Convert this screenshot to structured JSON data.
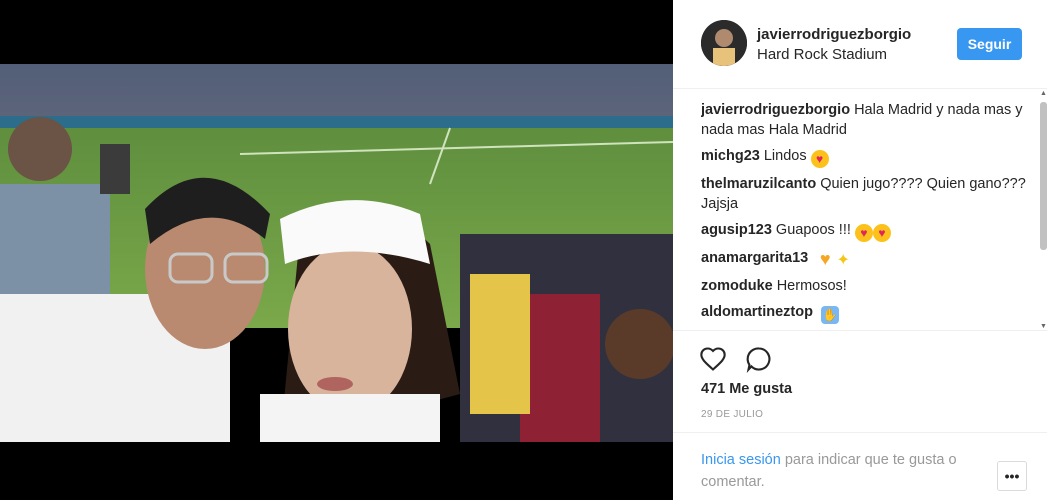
{
  "post": {
    "username": "javierrodriguezborgio",
    "location": "Hard Rock Stadium",
    "follow_label": "Seguir",
    "likes": "471 Me gusta",
    "date": "29 DE JULIO"
  },
  "comments": [
    {
      "user": "javierrodriguezborgio",
      "text": "Hala Madrid y nada mas y nada mas Hala Madrid",
      "emojis": []
    },
    {
      "user": "michg23",
      "text": "Lindos",
      "emojis": [
        "heart-eyes"
      ]
    },
    {
      "user": "thelmaruzilcanto",
      "text": "Quien jugo???? Quien gano??? Jajsja",
      "emojis": []
    },
    {
      "user": "agusip123",
      "text": "Guapoos !!!",
      "emojis": [
        "heart-eyes",
        "heart-eyes"
      ]
    },
    {
      "user": "anamargarita13",
      "text": "",
      "emojis": [
        "yellow-heart",
        "sparkles"
      ]
    },
    {
      "user": "zomoduke",
      "text": "Hermosos!",
      "emojis": []
    },
    {
      "user": "aldomartineztop",
      "text": "",
      "emojis": [
        "raised-hands"
      ]
    }
  ],
  "login": {
    "link": "Inicia sesión",
    "text": " para indicar que te gusta o comentar."
  },
  "more_label": "•••",
  "colors": {
    "accent": "#3897f0",
    "text": "#262626",
    "muted": "#999999"
  }
}
